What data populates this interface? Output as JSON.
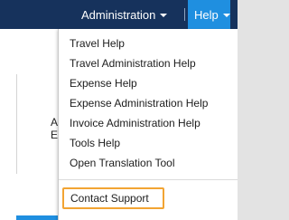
{
  "topbar": {
    "admin_label": "Administration",
    "help_label": "Help"
  },
  "background": {
    "line1": "A",
    "line2": "E"
  },
  "help_menu": {
    "items": [
      "Travel Help",
      "Travel Administration Help",
      "Expense Help",
      "Expense Administration Help",
      "Invoice Administration Help",
      "Tools Help",
      "Open Translation Tool"
    ],
    "contact_support": "Contact Support"
  },
  "colors": {
    "topbar": "#16325c",
    "help_active": "#1f8fe0",
    "highlight_border": "#f2a433"
  }
}
